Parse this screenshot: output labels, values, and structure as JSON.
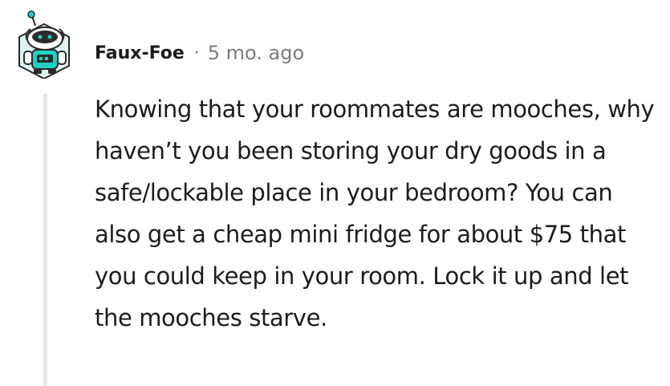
{
  "comment": {
    "author": "Faux-Foe",
    "separator": "·",
    "timestamp": "5 mo. ago",
    "avatar_icon": "snoo-robot-avatar-icon",
    "body": "Knowing that your roommates are mooches, why haven’t you been storing your dry goods in a safe/lockable place in your bedroom? You can also get a cheap mini fridge for about $75 that you could keep in your room. Lock it up and let the mooches starve."
  },
  "colors": {
    "text": "#1c1c1c",
    "meta": "#7c7c7c",
    "thread_line": "#e5e5e5",
    "avatar_accent": "#1fd1c2"
  }
}
